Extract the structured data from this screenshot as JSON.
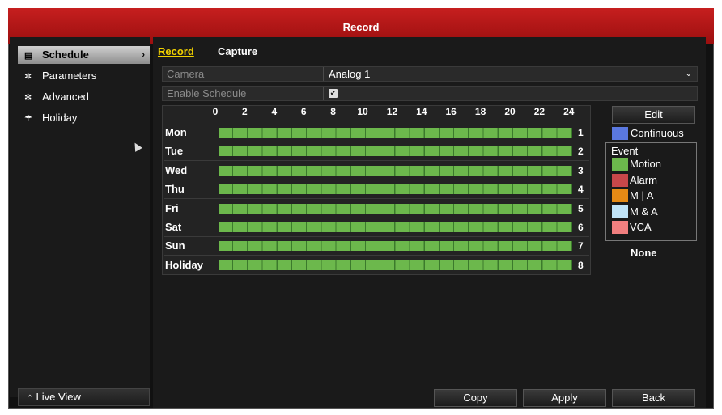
{
  "window": {
    "title": "Record"
  },
  "sidebar": {
    "items": [
      {
        "label": "Schedule",
        "icon": "schedule-icon",
        "glyph": "▤",
        "active": true
      },
      {
        "label": "Parameters",
        "icon": "gear-icon",
        "glyph": "✲",
        "active": false
      },
      {
        "label": "Advanced",
        "icon": "gears-icon",
        "glyph": "✻",
        "active": false
      },
      {
        "label": "Holiday",
        "icon": "umbrella-icon",
        "glyph": "☂",
        "active": false
      }
    ],
    "live_view": "Live View",
    "live_view_glyph": "⌂",
    "chev": "›"
  },
  "tabs": [
    {
      "label": "Record",
      "active": true
    },
    {
      "label": "Capture",
      "active": false
    }
  ],
  "form": {
    "camera_label": "Camera",
    "camera_value": "Analog 1",
    "camera_dd": "⌄",
    "enable_label": "Enable Schedule",
    "enable_checked": true,
    "check_glyph": "✔"
  },
  "schedule": {
    "hours": [
      "0",
      "2",
      "4",
      "6",
      "8",
      "10",
      "12",
      "14",
      "16",
      "18",
      "20",
      "22",
      "24"
    ],
    "days": [
      {
        "label": "Mon",
        "num": "1"
      },
      {
        "label": "Tue",
        "num": "2"
      },
      {
        "label": "Wed",
        "num": "3"
      },
      {
        "label": "Thu",
        "num": "4"
      },
      {
        "label": "Fri",
        "num": "5"
      },
      {
        "label": "Sat",
        "num": "6"
      },
      {
        "label": "Sun",
        "num": "7"
      },
      {
        "label": "Holiday",
        "num": "8"
      }
    ]
  },
  "legend": {
    "edit": "Edit",
    "continuous": {
      "label": "Continuous",
      "color": "#5a78e0"
    },
    "event_title": "Event",
    "items": [
      {
        "label": "Motion",
        "color": "#6cb84c"
      },
      {
        "label": "Alarm",
        "color": "#c8484a"
      },
      {
        "label": "M | A",
        "color": "#e58a15"
      },
      {
        "label": "M & A",
        "color": "#bfe3f7"
      },
      {
        "label": "VCA",
        "color": "#f17f7f"
      }
    ],
    "none": "None"
  },
  "buttons": {
    "copy": "Copy",
    "apply": "Apply",
    "back": "Back"
  }
}
